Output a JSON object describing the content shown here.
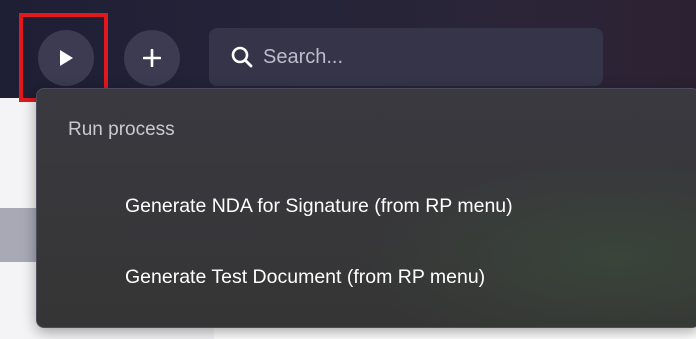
{
  "toolbar": {
    "run_button_icon": "play-icon",
    "add_button_icon": "plus-icon"
  },
  "search": {
    "icon": "search-icon",
    "placeholder": "Search..."
  },
  "run_menu": {
    "heading": "Run process",
    "items": [
      {
        "label": "Generate NDA for Signature (from RP menu)"
      },
      {
        "label": "Generate Test Document (from RP menu)"
      }
    ]
  },
  "highlight": {
    "target": "run-process-button",
    "color": "#e0191e"
  },
  "colors": {
    "header_bg": "#262439",
    "menu_bg": "#373639",
    "button_bg": "#3c3b51",
    "search_bg": "#353449"
  }
}
